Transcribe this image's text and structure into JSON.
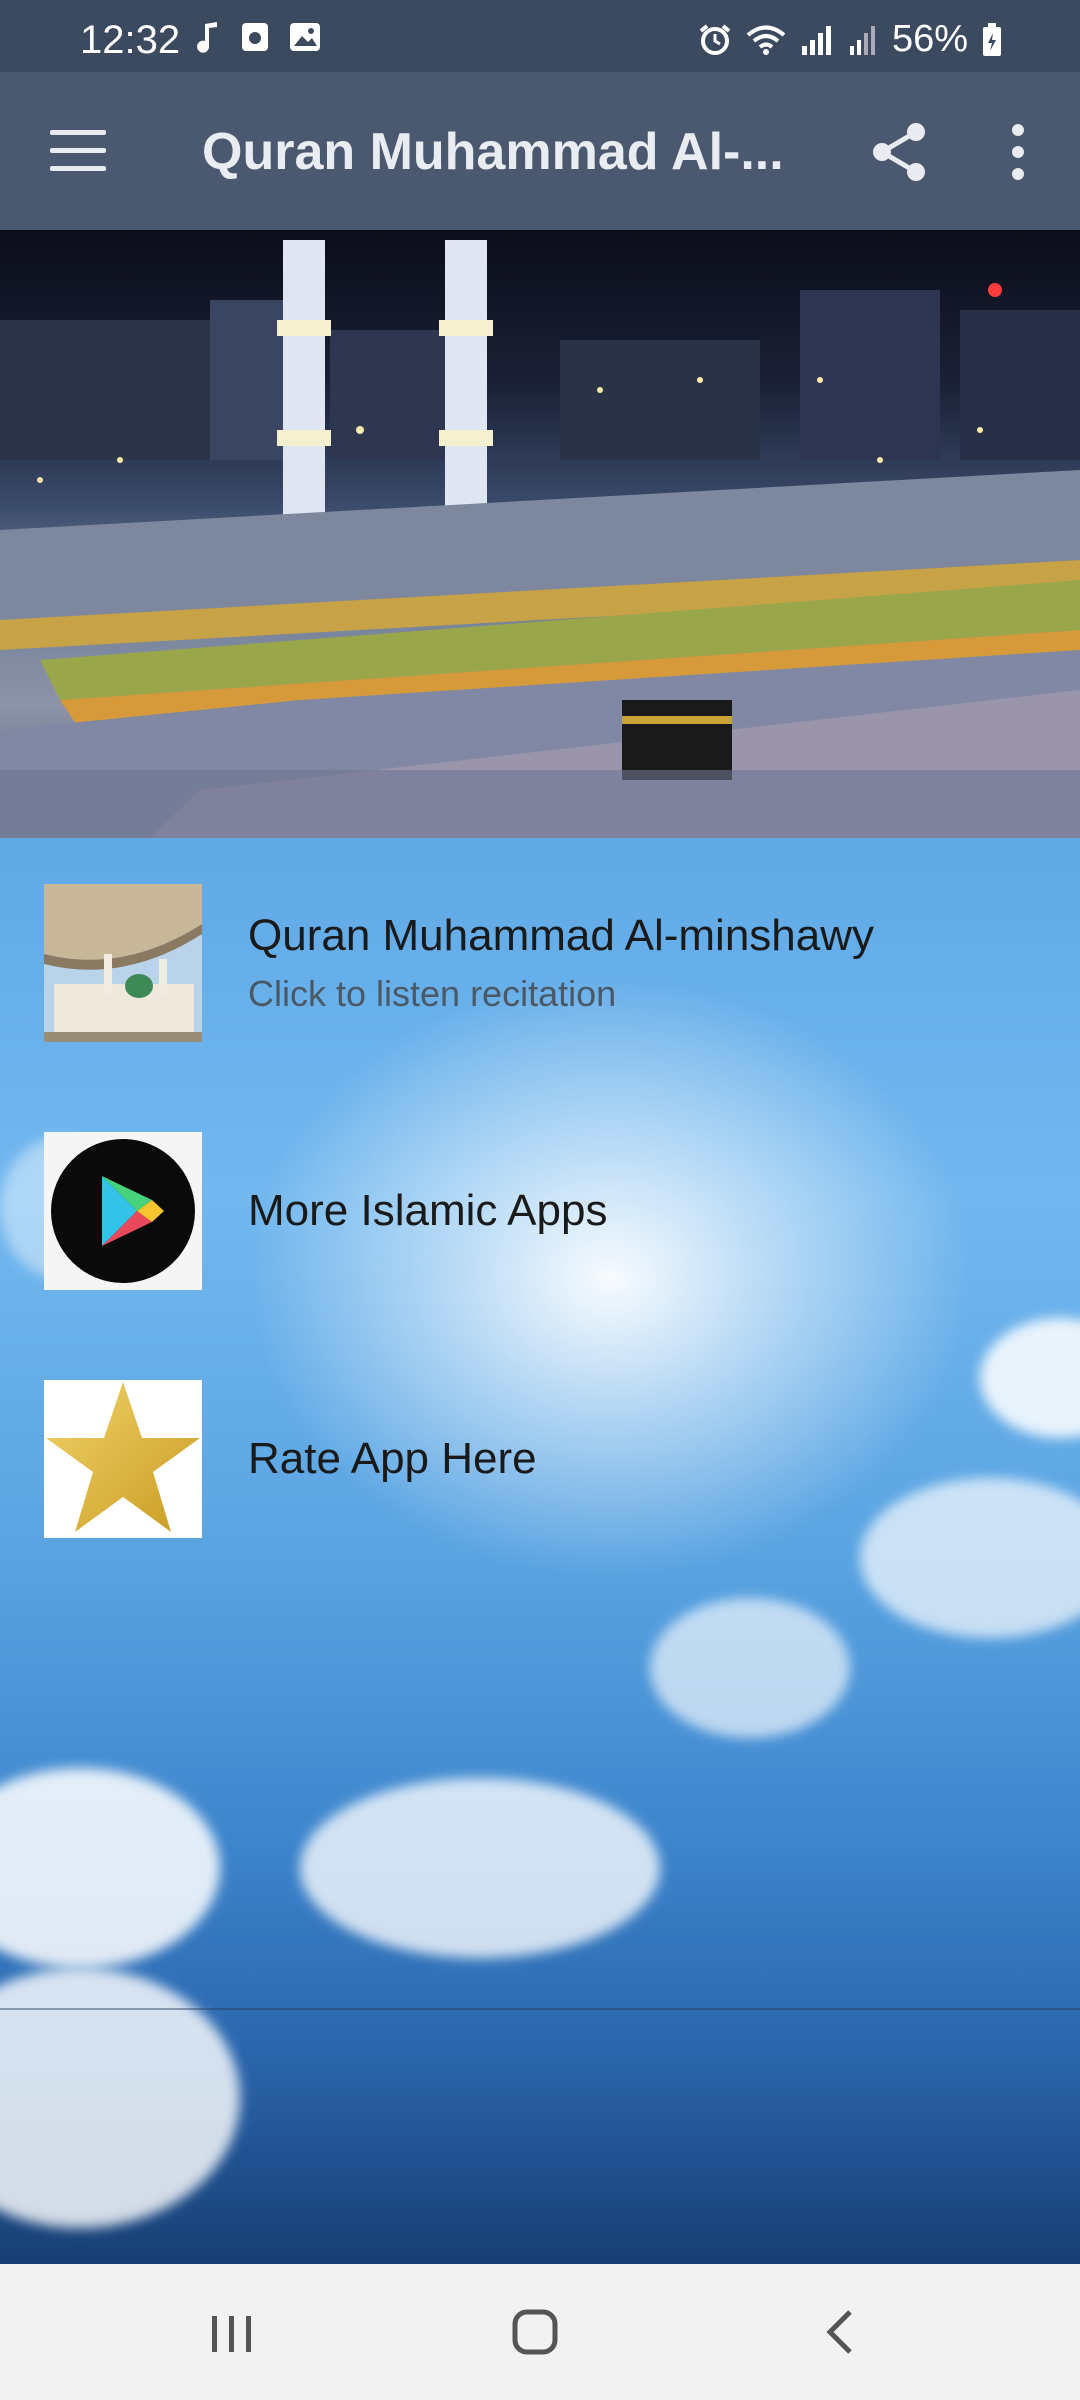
{
  "status_bar": {
    "time": "12:32",
    "battery": "56%",
    "left_icons": [
      "music-note-icon",
      "media-icon",
      "gallery-icon"
    ],
    "right_icons": [
      "alarm-icon",
      "wifi-icon",
      "signal-icon",
      "signal-icon",
      "battery-icon"
    ]
  },
  "toolbar": {
    "title": "Quran Muhammad Al-...",
    "icons": [
      "menu-icon",
      "share-icon",
      "more-vert-icon"
    ],
    "background": "#4a5870"
  },
  "list": {
    "items": [
      {
        "title": "Quran Muhammad Al-minshawy",
        "subtitle": "Click to listen recitation",
        "icon": "mosque-thumbnail"
      },
      {
        "title": "More Islamic Apps",
        "icon": "play-store-icon"
      },
      {
        "title": "Rate App Here",
        "icon": "star-icon"
      }
    ]
  },
  "nav_bar": {
    "buttons": [
      "recent-apps-icon",
      "home-icon",
      "back-icon"
    ]
  },
  "colors": {
    "status_bar": "#3c4a60",
    "toolbar": "#4a5870",
    "star": "#e3b93a"
  }
}
